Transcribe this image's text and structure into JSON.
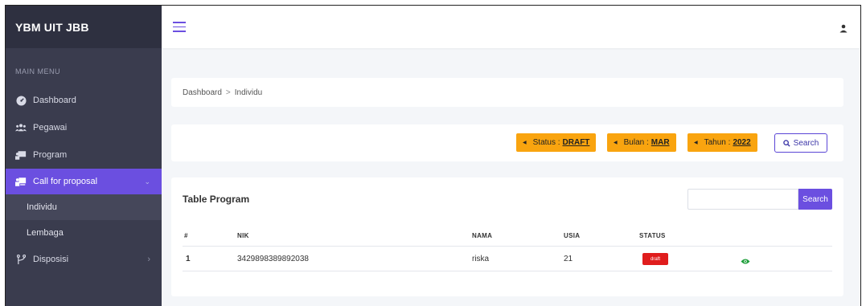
{
  "brand": "YBM UIT JBB",
  "sidebar": {
    "header": "MAIN MENU",
    "items": [
      {
        "label": "Dashboard"
      },
      {
        "label": "Pegawai"
      },
      {
        "label": "Program"
      },
      {
        "label": "Call for proposal"
      },
      {
        "label": "Individu"
      },
      {
        "label": "Lembaga"
      },
      {
        "label": "Disposisi"
      }
    ]
  },
  "breadcrumb": {
    "items": [
      "Dashboard",
      "Individu"
    ],
    "separator": ">"
  },
  "filters": {
    "status_label": "Status :",
    "status_value": "DRAFT",
    "bulan_label": "Bulan :",
    "bulan_value": "MAR",
    "tahun_label": "Tahun :",
    "tahun_value": "2022",
    "search_label": "Search"
  },
  "table": {
    "title": "Table Program",
    "search_button": "Search",
    "columns": [
      "#",
      "NIK",
      "NAMA",
      "USIA",
      "STATUS"
    ],
    "rows": [
      {
        "no": "1",
        "nik": "3429898389892038",
        "nama": "riska",
        "usia": "21",
        "status": "draft"
      }
    ]
  },
  "colors": {
    "accent": "#6b4fe0",
    "filter_button": "#f9a40f",
    "status_draft": "#e01d1d",
    "sidebar_bg": "#3a3c4e"
  }
}
